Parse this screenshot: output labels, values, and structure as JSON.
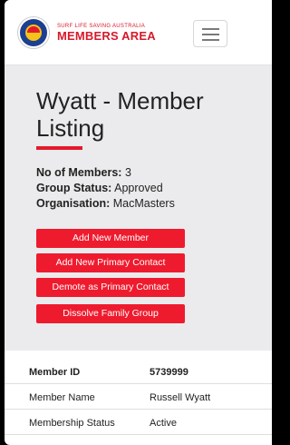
{
  "header": {
    "brand_small": "SURF LIFE SAVING AUSTRALIA",
    "brand_big": "MEMBERS AREA",
    "logo_icon": "slsa-logo-icon",
    "menu_icon": "hamburger-menu-icon"
  },
  "page": {
    "title": "Wyatt - Member Listing",
    "members_label": "No of Members:",
    "members_value": "3",
    "status_label": "Group Status:",
    "status_value": "Approved",
    "org_label": "Organisation:",
    "org_value": "MacMasters"
  },
  "actions": {
    "add_member": "Add New Member",
    "add_primary": "Add New Primary Contact",
    "demote_primary": "Demote as Primary Contact",
    "dissolve": "Dissolve Family Group"
  },
  "member_table": {
    "rows": [
      {
        "key": "Member ID",
        "value": "5739999"
      },
      {
        "key": "Member Name",
        "value": "Russell Wyatt"
      },
      {
        "key": "Membership Status",
        "value": "Active"
      }
    ]
  },
  "colors": {
    "accent": "#ee1b2e",
    "panel": "#ebebed",
    "brand": "#d7192a"
  }
}
